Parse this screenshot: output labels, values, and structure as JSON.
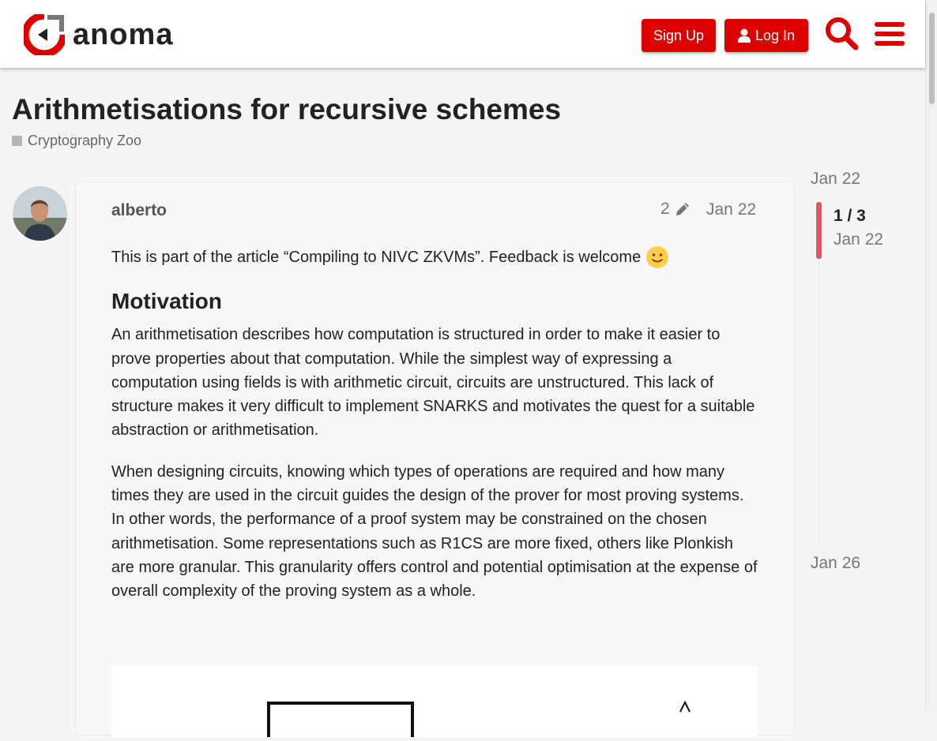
{
  "header": {
    "logo_text": "anoma",
    "signup_label": "Sign Up",
    "login_label": "Log In",
    "icons": {
      "search": "search-icon",
      "menu": "hamburger-menu-icon",
      "user": "user-icon"
    },
    "accent_color": "#dd0000"
  },
  "topic": {
    "title": "Arithmetisations for recursive schemes",
    "category": "Cryptography Zoo"
  },
  "post": {
    "username": "alberto",
    "edit_count": "2",
    "date": "Jan 22",
    "intro": "This is part of the article “Compiling to NIVC ZKVMs”. Feedback is welcome",
    "heading": "Motivation",
    "paragraph1": "An arithmetisation describes how computation is structured in order to make it easier to prove properties about that computation. While the simplest way of expressing a computation using fields is with arithmetic circuit, circuits are unstructured. This lack of structure makes it very difficult to implement SNARKS and motivates the quest for a suitable abstraction or arithmetisation.",
    "paragraph2": "When designing circuits, knowing which types of operations are required and how many times they are used in the circuit guides the design of the prover for most proving systems. In other words, the performance of a proof system may be constrained on the chosen arithmetisation. Some representations such as R1CS are more fixed, others like Plonkish are more granular. This granularity offers control and potential optimisation at the expense of overall complexity of the proving system as a whole."
  },
  "timeline": {
    "start_date": "Jan 22",
    "position": "1 / 3",
    "position_date": "Jan 22",
    "end_date": "Jan 26",
    "handle_color": "#e45367"
  }
}
